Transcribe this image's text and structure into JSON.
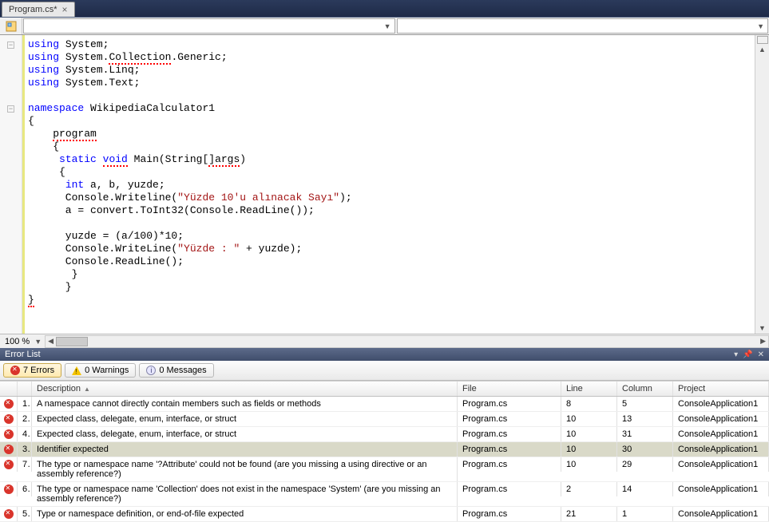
{
  "tab": {
    "filename": "Program.cs*",
    "close": "×"
  },
  "editor": {
    "zoom": "100 %"
  },
  "errorPanel": {
    "title": "Error List",
    "buttons": {
      "errors": "7 Errors",
      "warnings": "0 Warnings",
      "messages": "0 Messages"
    },
    "columns": {
      "description": "Description",
      "file": "File",
      "line": "Line",
      "column": "Column",
      "project": "Project"
    }
  },
  "code": {
    "lines": [
      {
        "type": "using",
        "ns": "System"
      },
      {
        "type": "using",
        "nsErr": "System.Collection.Generic"
      },
      {
        "type": "using",
        "ns": "System.Linq"
      },
      {
        "type": "using",
        "ns": "System.Text"
      },
      {
        "type": "blank"
      },
      {
        "type": "namespace",
        "name": "WikipediaCalculator1"
      },
      {
        "type": "brace-open"
      },
      {
        "type": "program"
      },
      {
        "type": "brace-open2"
      },
      {
        "type": "main"
      },
      {
        "type": "brace-open3"
      },
      {
        "type": "intdecl"
      },
      {
        "type": "writeline1",
        "str": "\"Yüzde 10'u alınacak Sayı\""
      },
      {
        "type": "readline-assign"
      },
      {
        "type": "blank"
      },
      {
        "type": "calc"
      },
      {
        "type": "writeline2",
        "str": "\"Yüzde : \""
      },
      {
        "type": "readline"
      },
      {
        "type": "brace-close3"
      },
      {
        "type": "brace-close2"
      },
      {
        "type": "brace-close"
      }
    ]
  },
  "errors": [
    {
      "num": "1",
      "desc": "A namespace cannot directly contain members such as fields or methods",
      "file": "Program.cs",
      "line": "8",
      "col": "5",
      "proj": "ConsoleApplication1",
      "sel": false
    },
    {
      "num": "2",
      "desc": "Expected class, delegate, enum, interface, or struct",
      "file": "Program.cs",
      "line": "10",
      "col": "13",
      "proj": "ConsoleApplication1",
      "sel": false
    },
    {
      "num": "4",
      "desc": "Expected class, delegate, enum, interface, or struct",
      "file": "Program.cs",
      "line": "10",
      "col": "31",
      "proj": "ConsoleApplication1",
      "sel": false
    },
    {
      "num": "3",
      "desc": "Identifier expected",
      "file": "Program.cs",
      "line": "10",
      "col": "30",
      "proj": "ConsoleApplication1",
      "sel": true
    },
    {
      "num": "7",
      "desc": "The type or namespace name '?Attribute' could not be found (are you missing a using directive or an assembly reference?)",
      "file": "Program.cs",
      "line": "10",
      "col": "29",
      "proj": "ConsoleApplication1",
      "sel": false
    },
    {
      "num": "6",
      "desc": "The type or namespace name 'Collection' does not exist in the namespace 'System' (are you missing an assembly reference?)",
      "file": "Program.cs",
      "line": "2",
      "col": "14",
      "proj": "ConsoleApplication1",
      "sel": false
    },
    {
      "num": "5",
      "desc": "Type or namespace definition, or end-of-file expected",
      "file": "Program.cs",
      "line": "21",
      "col": "1",
      "proj": "ConsoleApplication1",
      "sel": false
    }
  ]
}
